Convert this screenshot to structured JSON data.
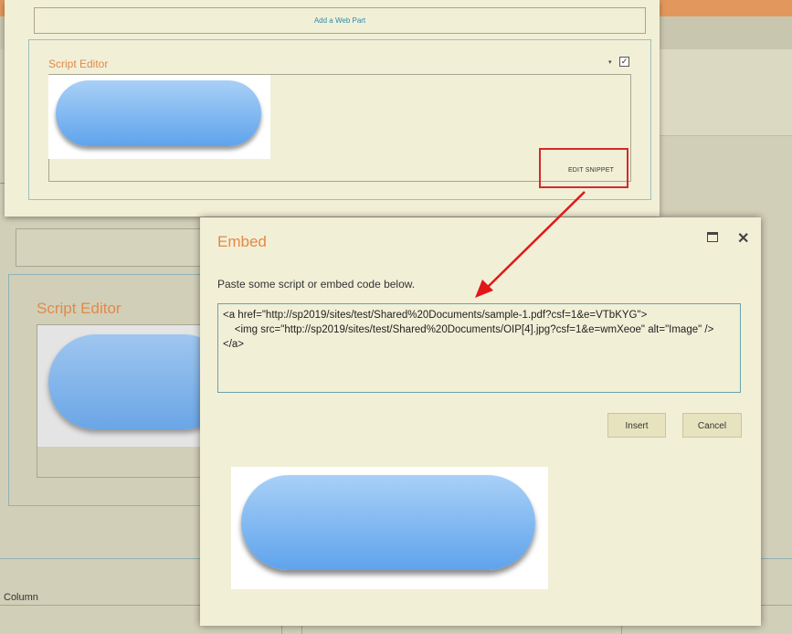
{
  "background": {
    "editor_title": "Script Editor",
    "column_label": "Column"
  },
  "top_panel": {
    "add_webpart_label": "Add a Web Part",
    "editor_title": "Script Editor",
    "menu_arrow": "▾",
    "checkbox_mark": "✓",
    "edit_snippet_label": "EDIT SNIPPET"
  },
  "dialog": {
    "title": "Embed",
    "instruction": "Paste some script or embed code below.",
    "code": "<a href=\"http://sp2019/sites/test/Shared%20Documents/sample-1.pdf?csf=1&e=VTbKYG\">\n    <img src=\"http://sp2019/sites/test/Shared%20Documents/OIP[4].jpg?csf=1&e=wmXeoe\" alt=\"Image\" />\n</a>",
    "insert_label": "Insert",
    "cancel_label": "Cancel",
    "close_glyph": "✕"
  },
  "colors": {
    "accent_orange": "#e08a4a",
    "highlight_red": "#d42a2a",
    "link_teal": "#2a8ea8",
    "panel_bg": "#f2efd7"
  }
}
